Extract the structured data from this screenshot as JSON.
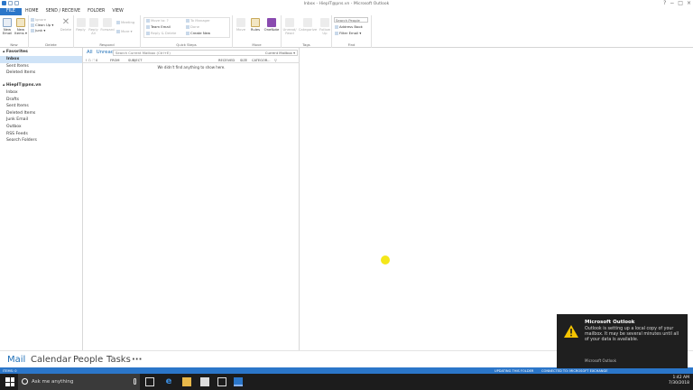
{
  "window": {
    "title": "Inbox - HiepIT@pns.vn - Microsoft Outlook",
    "controls": [
      "?",
      "−",
      "□",
      "×"
    ]
  },
  "tabs": [
    "FILE",
    "HOME",
    "SEND / RECEIVE",
    "FOLDER",
    "VIEW"
  ],
  "ribbon": {
    "new": {
      "new_email": "New Email",
      "new_items": "New Items ▾",
      "group": "New"
    },
    "delete": {
      "ignore": "Ignore",
      "clean_up": "Clean Up ▾",
      "junk": "Junk ▾",
      "delete": "Delete",
      "group": "Delete"
    },
    "respond": {
      "reply": "Reply",
      "reply_all": "Reply All",
      "forward": "Forward",
      "meeting": "Meeting",
      "more": "More ▾",
      "group": "Respond"
    },
    "quick_steps": {
      "items": [
        "Move to: ?",
        "Team Email",
        "Reply & Delete",
        "To Manager",
        "Done",
        "Create New"
      ],
      "group": "Quick Steps"
    },
    "move": {
      "move": "Move",
      "rules": "Rules",
      "onenote": "OneNote",
      "group": "Move"
    },
    "tags": {
      "unread_read": "Unread/ Read",
      "categorize": "Categorize",
      "follow_up": "Follow Up",
      "group": "Tags"
    },
    "find": {
      "search_people": "Search People",
      "address_book": "Address Book",
      "filter_email": "Filter Email ▾",
      "group": "Find"
    }
  },
  "nav": {
    "favorites_title": "Favorites",
    "favorites": [
      "Inbox",
      "Sent Items",
      "Deleted Items"
    ],
    "account": "HiepIT@pns.vn",
    "folders": [
      "Inbox",
      "Drafts",
      "Sent Items",
      "Deleted Items",
      "Junk Email",
      "Outbox",
      "RSS Feeds",
      "Search Folders"
    ]
  },
  "list": {
    "filter_all": "All",
    "filter_unread": "Unread",
    "search_placeholder": "Search Current Mailbox (Ctrl+E)",
    "search_scope": "Current Mailbox ▾",
    "columns": [
      "! ☖ 🗋 0",
      "FROM",
      "SUBJECT",
      "RECEIVED",
      "SIZE",
      "CATEGOR...",
      "▽"
    ],
    "empty_message": "We didn't find anything to show here."
  },
  "bottom_nav": [
    "Mail",
    "Calendar",
    "People",
    "Tasks",
    "···"
  ],
  "status": {
    "items": "ITEMS: 0",
    "updating": "UPDATING THIS FOLDER",
    "connected": "CONNECTED TO: MICROSOFT EXCHANGE"
  },
  "taskbar": {
    "search_placeholder": "Ask me anything",
    "time": "1:42 AM",
    "date": "7/30/2018"
  },
  "toast": {
    "title": "Microsoft Outlook",
    "message": "Outlook is setting up a local copy of your mailbox. It may be several minutes until all of your data is available.",
    "source": "Microsoft Outlook"
  },
  "colors": {
    "accent": "#2b76c9",
    "selection": "#cfe3f7",
    "toast_bg": "#1f1f1f",
    "warning": "#f5c400"
  }
}
